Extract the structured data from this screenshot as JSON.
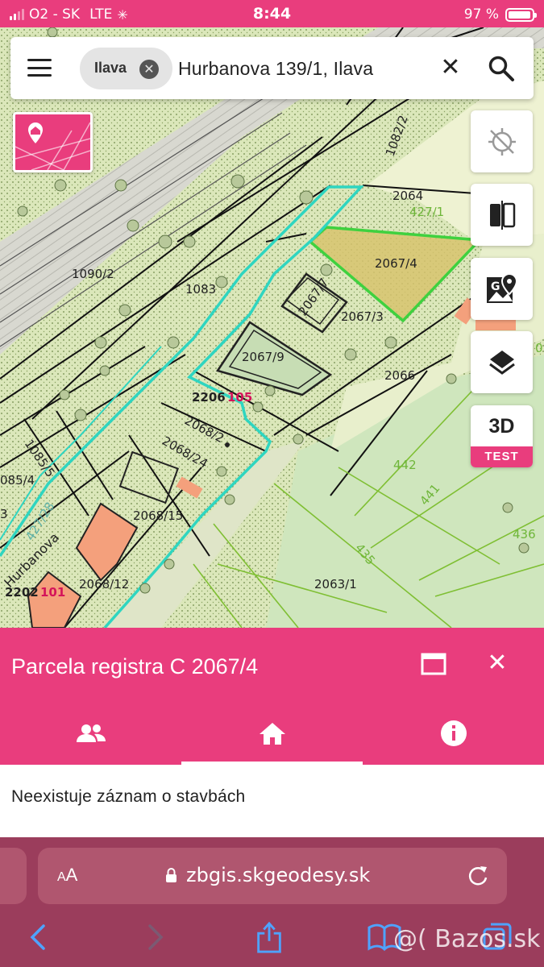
{
  "status_bar": {
    "carrier": "O2 - SK",
    "network": "LTE",
    "time": "8:44",
    "battery": "97 %"
  },
  "search": {
    "menu_icon": "hamburger-menu-icon",
    "chip_label": "Ilava",
    "query": "Hurbanova 139/1, Ilava"
  },
  "map": {
    "parcel_labels": [
      "2064",
      "427/1",
      "2067/4",
      "2067/7",
      "2067/3",
      "2067/9",
      "2066",
      "1090/2",
      "1083",
      "1082/2",
      "2206",
      "105",
      "2068/2",
      "2068/24",
      "1085/5",
      "085/4",
      "2068/15",
      "427/28",
      "Hurbanova",
      "2068/12",
      "2202",
      "101",
      "2063/1",
      "442",
      "441",
      "435",
      "436",
      "3",
      "0"
    ],
    "selected_parcel": "2067/4",
    "colors": {
      "selection": "#3fd13f",
      "boundary": "#2fd5c0",
      "highlight_fill": "#d9c46b",
      "building": "#f4a07c"
    }
  },
  "map_buttons": {
    "basemap": "basemap-thumbnail",
    "locate": "locate-icon",
    "swipe": "compare-swipe-icon",
    "geo": "geo-map-icon",
    "layers": "layers-icon",
    "three_d_label": "3D",
    "three_d_badge": "TEST"
  },
  "panel": {
    "title": "Parcela registra C 2067/4",
    "tabs": [
      {
        "icon": "owners-icon",
        "active": false
      },
      {
        "icon": "home-icon",
        "active": true
      },
      {
        "icon": "info-icon",
        "active": false
      }
    ],
    "content": "Neexistuje záznam o stavbách"
  },
  "browser": {
    "aa_label": "AA",
    "url": "zbgis.skgeodesy.sk",
    "watermark": "Bazos.sk"
  },
  "theme": {
    "accent": "#e93d7d",
    "browser_bar": "#9b3d5c"
  }
}
